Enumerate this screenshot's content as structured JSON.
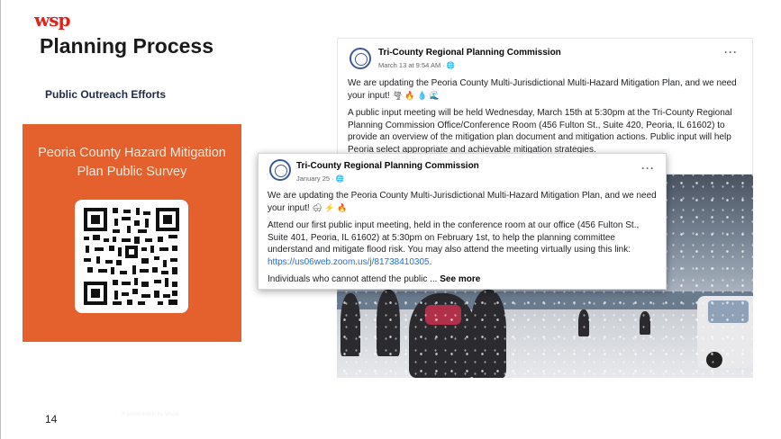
{
  "slide": {
    "logo": "wsp",
    "title": "Planning Process",
    "subtitle": "Public Outreach Efforts",
    "page_number": "14",
    "watermark": "A presentation by Wood"
  },
  "survey": {
    "title_line1": "Peoria County Hazard Mitigation",
    "title_line2": "Plan Public Survey",
    "qr_icon": "qr-code-icon",
    "bg_color": "#e4612d"
  },
  "post_back": {
    "author": "Tri-County Regional Planning Commission",
    "meta": "March 13 at 9:54 AM · 🌐",
    "menu": "···",
    "para1": "We are updating the Peoria County Multi-Jurisdictional Multi-Hazard Mitigation Plan, and we need your input!",
    "para1_emoji": "🌪 🔥 💧 🌊",
    "para2": "A public input meeting will be held Wednesday, March 15th at 5:30pm at the Tri-County Regional Planning Commission Office/Conference Room (456 Fulton St., Suite 420, Peoria, IL 61602) to provide an overview of the mitigation plan document and mitigation actions.  Public input will help Peoria select appropriate and achievable mitigation strategies."
  },
  "post_front": {
    "author": "Tri-County Regional Planning Commission",
    "meta": "January 25 · 🌐",
    "menu": "···",
    "para1": "We are updating the Peoria County Multi-Jurisdictional Multi-Hazard Mitigation Plan, and we need your input!",
    "para1_emoji": "🌨 ⚡ 🔥",
    "para2": "Attend our first public input meeting, held in the conference room at our office (456 Fulton St., Suite 401, Peoria, IL 61602) at 5:30pm on February 1st, to help the planning committee understand and mitigate flood risk.  You may also attend the meeting virtually using this link:",
    "link": "https://us06web.zoom.us/j/81738410305",
    "link_suffix": ".",
    "para3": "Individuals who cannot attend the public ...",
    "see_more": "See more"
  },
  "colors": {
    "brand_red": "#e2231a",
    "facebook_blue": "#3b5998",
    "link_blue": "#216fdb"
  }
}
